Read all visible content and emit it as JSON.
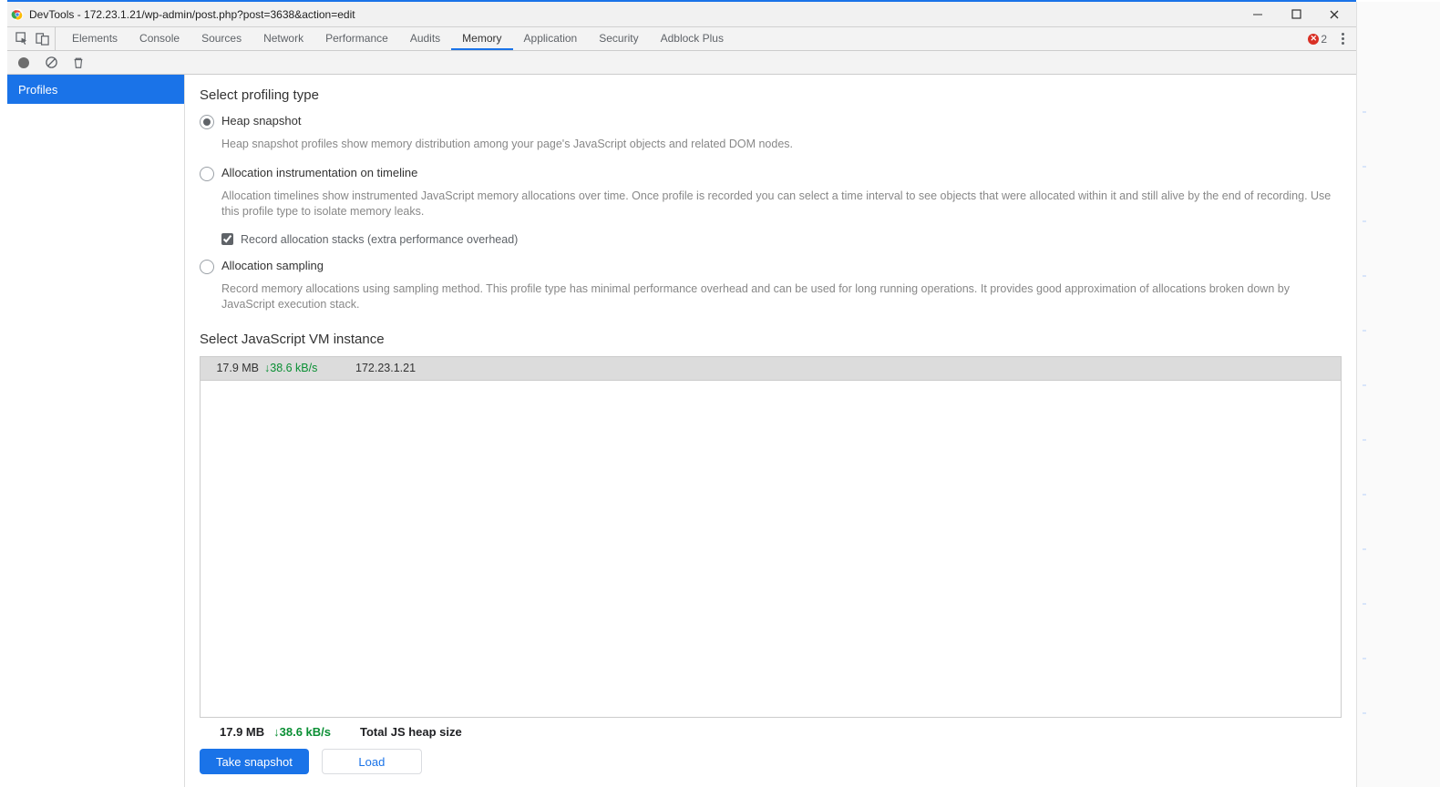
{
  "window": {
    "title": "DevTools - 172.23.1.21/wp-admin/post.php?post=3638&action=edit"
  },
  "tabs": {
    "items": [
      "Elements",
      "Console",
      "Sources",
      "Network",
      "Performance",
      "Audits",
      "Memory",
      "Application",
      "Security",
      "Adblock Plus"
    ],
    "active": "Memory",
    "errors": "2"
  },
  "sidebar": {
    "profiles": "Profiles"
  },
  "profiling": {
    "section_title": "Select profiling type",
    "heap": {
      "label": "Heap snapshot",
      "desc": "Heap snapshot profiles show memory distribution among your page's JavaScript objects and related DOM nodes."
    },
    "timeline": {
      "label": "Allocation instrumentation on timeline",
      "desc": "Allocation timelines show instrumented JavaScript memory allocations over time. Once profile is recorded you can select a time interval to see objects that were allocated within it and still alive by the end of recording. Use this profile type to isolate memory leaks.",
      "checkbox": "Record allocation stacks (extra performance overhead)"
    },
    "sampling": {
      "label": "Allocation sampling",
      "desc": "Record memory allocations using sampling method. This profile type has minimal performance overhead and can be used for long running operations. It provides good approximation of allocations broken down by JavaScript execution stack."
    }
  },
  "vm": {
    "title": "Select JavaScript VM instance",
    "row": {
      "size": "17.9 MB",
      "rate_arrow": "↓",
      "rate": "38.6 kB/s",
      "host": "172.23.1.21"
    }
  },
  "status": {
    "size": "17.9 MB",
    "rate_arrow": "↓",
    "rate": "38.6 kB/s",
    "label": "Total JS heap size"
  },
  "actions": {
    "primary": "Take snapshot",
    "secondary": "Load"
  }
}
